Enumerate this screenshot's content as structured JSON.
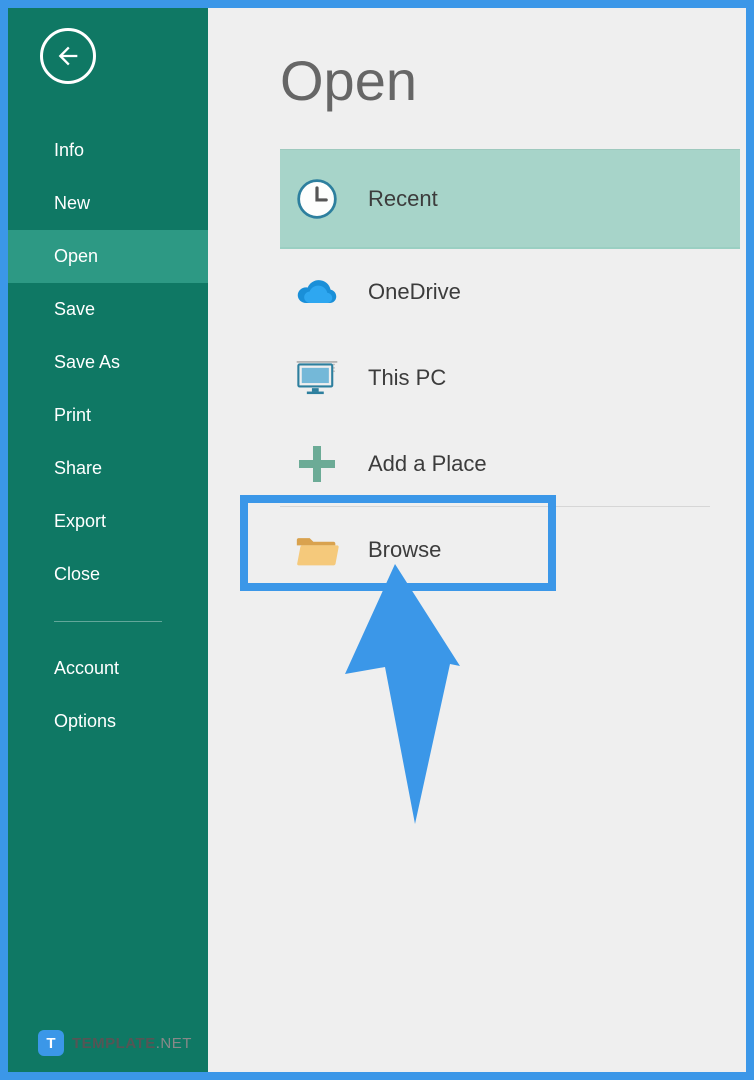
{
  "page": {
    "title": "Open"
  },
  "sidebar": {
    "items": [
      {
        "label": "Info"
      },
      {
        "label": "New"
      },
      {
        "label": "Open"
      },
      {
        "label": "Save"
      },
      {
        "label": "Save As"
      },
      {
        "label": "Print"
      },
      {
        "label": "Share"
      },
      {
        "label": "Export"
      },
      {
        "label": "Close"
      }
    ],
    "footer": [
      {
        "label": "Account"
      },
      {
        "label": "Options"
      }
    ],
    "active_index": 2
  },
  "locations": {
    "items": [
      {
        "label": "Recent",
        "icon": "clock-icon",
        "selected": true
      },
      {
        "label": "OneDrive",
        "icon": "cloud-icon"
      },
      {
        "label": "This PC",
        "icon": "monitor-icon"
      },
      {
        "label": "Add a Place",
        "icon": "plus-icon"
      },
      {
        "label": "Browse",
        "icon": "folder-icon"
      }
    ]
  },
  "annotation": {
    "highlight_index": 3
  },
  "watermark": {
    "badge": "T",
    "text_bold": "TEMPLATE",
    "text_light": ".NET"
  }
}
